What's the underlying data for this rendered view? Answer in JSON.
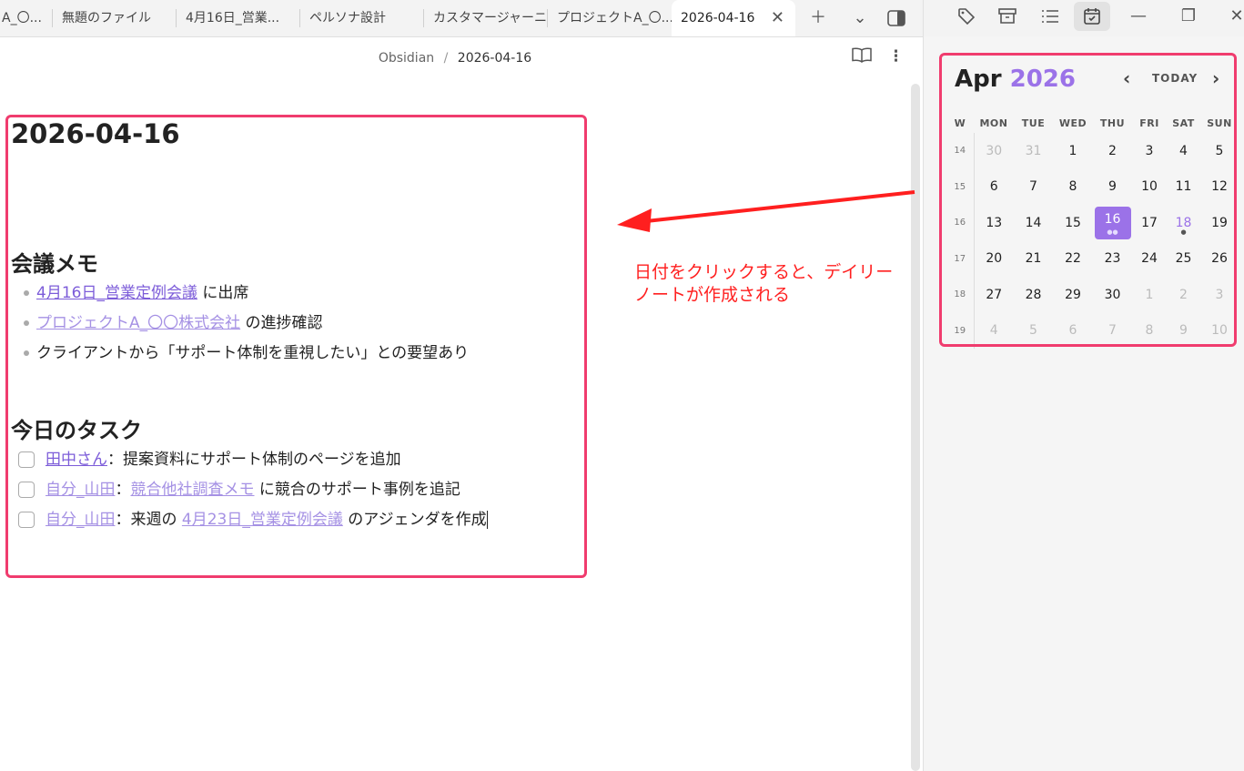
{
  "tabs": [
    {
      "label": "A_〇..."
    },
    {
      "label": "無題のファイル"
    },
    {
      "label": "4月16日_営業..."
    },
    {
      "label": "ペルソナ設計"
    },
    {
      "label": "カスタマージャーニー"
    },
    {
      "label": "プロジェクトA_〇..."
    },
    {
      "label": "2026-04-16",
      "active": true
    }
  ],
  "breadcrumb": {
    "root": "Obsidian",
    "sep": "/",
    "current": "2026-04-16"
  },
  "note": {
    "title": "2026-04-16",
    "meeting_heading": "会議メモ",
    "meeting_items": [
      {
        "link": "4月16日_営業定例会議",
        "text": " に出席"
      },
      {
        "link": "プロジェクトA_〇〇株式会社",
        "text": " の進捗確認"
      },
      {
        "link": "",
        "text": "クライアントから「サポート体制を重視したい」との要望あり"
      }
    ],
    "task_heading": "今日のタスク",
    "tasks": [
      {
        "link1": "田中さん",
        "mid": "：提案資料にサポート体制のページを追加",
        "link2": "",
        "tail": ""
      },
      {
        "link1": "自分_山田",
        "mid": "：",
        "link2": "競合他社調査メモ",
        "tail": " に競合のサポート事例を追記"
      },
      {
        "link1": "自分_山田",
        "mid": "：来週の ",
        "link2": "4月23日_営業定例会議",
        "tail": " のアジェンダを作成"
      }
    ]
  },
  "annotation": {
    "line1": "日付をクリックすると、デイリー",
    "line2": "ノートが作成される"
  },
  "calendar": {
    "month": "Apr",
    "year": "2026",
    "today_label": "TODAY",
    "headers": [
      "W",
      "MON",
      "TUE",
      "WED",
      "THU",
      "FRI",
      "SAT",
      "SUN"
    ],
    "weeks": [
      {
        "wk": "14",
        "days": [
          "30",
          "31",
          "1",
          "2",
          "3",
          "4",
          "5"
        ]
      },
      {
        "wk": "15",
        "days": [
          "6",
          "7",
          "8",
          "9",
          "10",
          "11",
          "12"
        ]
      },
      {
        "wk": "16",
        "days": [
          "13",
          "14",
          "15",
          "16",
          "17",
          "18",
          "19"
        ]
      },
      {
        "wk": "17",
        "days": [
          "20",
          "21",
          "22",
          "23",
          "24",
          "25",
          "26"
        ]
      },
      {
        "wk": "18",
        "days": [
          "27",
          "28",
          "29",
          "30",
          "1",
          "2",
          "3"
        ]
      },
      {
        "wk": "19",
        "days": [
          "4",
          "5",
          "6",
          "7",
          "8",
          "9",
          "10"
        ]
      }
    ],
    "selected_day": "16",
    "accent": "#9b72e8"
  },
  "colors": {
    "frame": "#f03c6e",
    "arrow": "#ff1f1f",
    "link": "#7c5cd9"
  }
}
